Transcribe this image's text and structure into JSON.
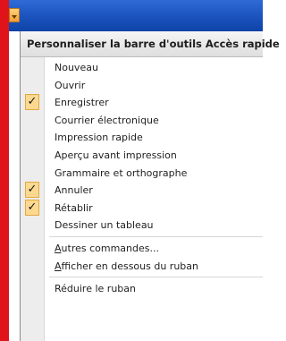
{
  "menu": {
    "header": "Personnaliser la barre d'outils Accès rapide",
    "items": [
      {
        "label": "Nouveau",
        "checked": false
      },
      {
        "label": "Ouvrir",
        "checked": false
      },
      {
        "label": "Enregistrer",
        "checked": true
      },
      {
        "label": "Courrier électronique",
        "checked": false
      },
      {
        "label": "Impression rapide",
        "checked": false
      },
      {
        "label": "Aperçu avant impression",
        "checked": false
      },
      {
        "label": "Grammaire et orthographe",
        "checked": false
      },
      {
        "label": "Annuler",
        "checked": true
      },
      {
        "label": "Rétablir",
        "checked": true
      },
      {
        "label": "Dessiner un tableau",
        "checked": false
      }
    ],
    "more_commands": {
      "accel": "A",
      "rest": "utres commandes..."
    },
    "show_below": {
      "accel": "A",
      "rest": "fficher en dessous du ruban"
    },
    "minimize_ribbon": "Réduire le ruban"
  },
  "icons": {
    "qat_dropdown": "dropdown-arrow-icon",
    "checkmark": "checkmark-icon"
  },
  "colors": {
    "titlebar": "#1f56c1",
    "frame": "#e0131a",
    "check_bg": "#fcd98f"
  }
}
